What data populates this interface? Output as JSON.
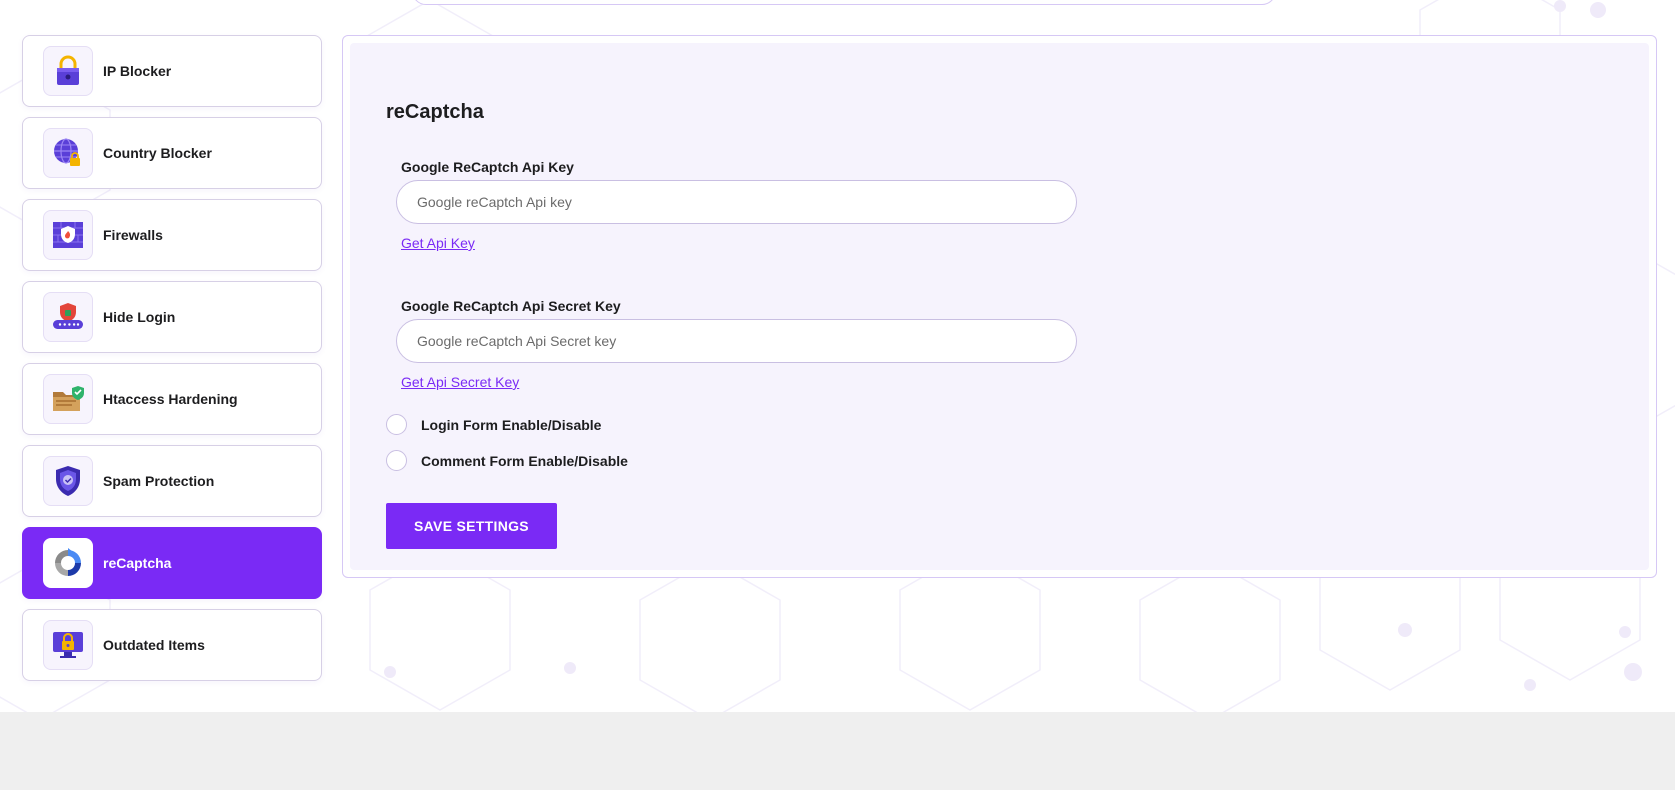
{
  "sidebar": {
    "items": [
      {
        "label": "IP Blocker",
        "icon": "padlock-icon"
      },
      {
        "label": "Country Blocker",
        "icon": "globe-lock-icon"
      },
      {
        "label": "Firewalls",
        "icon": "firewall-icon"
      },
      {
        "label": "Hide Login",
        "icon": "hidden-login-icon"
      },
      {
        "label": "Htaccess Hardening",
        "icon": "folder-shield-icon"
      },
      {
        "label": "Spam Protection",
        "icon": "shield-check-icon"
      },
      {
        "label": "reCaptcha",
        "icon": "recaptcha-icon",
        "active": true
      },
      {
        "label": "Outdated Items",
        "icon": "monitor-lock-icon"
      }
    ]
  },
  "panel": {
    "title": "reCaptcha",
    "api_key": {
      "label": "Google ReCaptch Api Key",
      "placeholder": "Google reCaptch Api key",
      "value": "",
      "link": "Get Api Key"
    },
    "secret_key": {
      "label": "Google ReCaptch Api Secret Key",
      "placeholder": "Google reCaptch Api Secret key",
      "value": "",
      "link": "Get Api Secret Key"
    },
    "login_form": {
      "label": "Login Form Enable/Disable",
      "checked": false
    },
    "comment_form": {
      "label": "Comment Form Enable/Disable",
      "checked": false
    },
    "save_label": "SAVE SETTINGS"
  },
  "colors": {
    "accent": "#7a2af5",
    "panel_bg": "#f6f3fd",
    "border": "#d6c8f5",
    "footer_bg": "#efefef"
  }
}
